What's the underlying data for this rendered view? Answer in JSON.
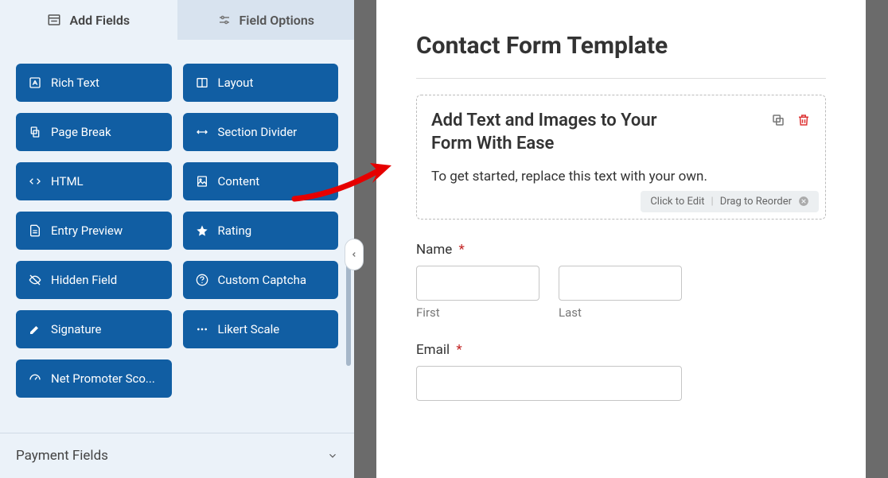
{
  "tabs": {
    "add_fields": "Add Fields",
    "field_options": "Field Options"
  },
  "fields": {
    "rich_text": "Rich Text",
    "layout": "Layout",
    "page_break": "Page Break",
    "section_divider": "Section Divider",
    "html": "HTML",
    "content": "Content",
    "entry_preview": "Entry Preview",
    "rating": "Rating",
    "hidden_field": "Hidden Field",
    "custom_captcha": "Custom Captcha",
    "signature": "Signature",
    "likert_scale": "Likert Scale",
    "net_promoter": "Net Promoter Sco..."
  },
  "payment_section": "Payment Fields",
  "form": {
    "title": "Contact Form Template",
    "content_block": {
      "heading": "Add Text and Images to Your Form With Ease",
      "description": "To get started, replace this text with your own."
    },
    "edit_hint": {
      "click": "Click to Edit",
      "drag": "Drag to Reorder"
    },
    "name_field": {
      "label": "Name",
      "required": "*",
      "first": "First",
      "last": "Last"
    },
    "email_field": {
      "label": "Email",
      "required": "*"
    }
  }
}
